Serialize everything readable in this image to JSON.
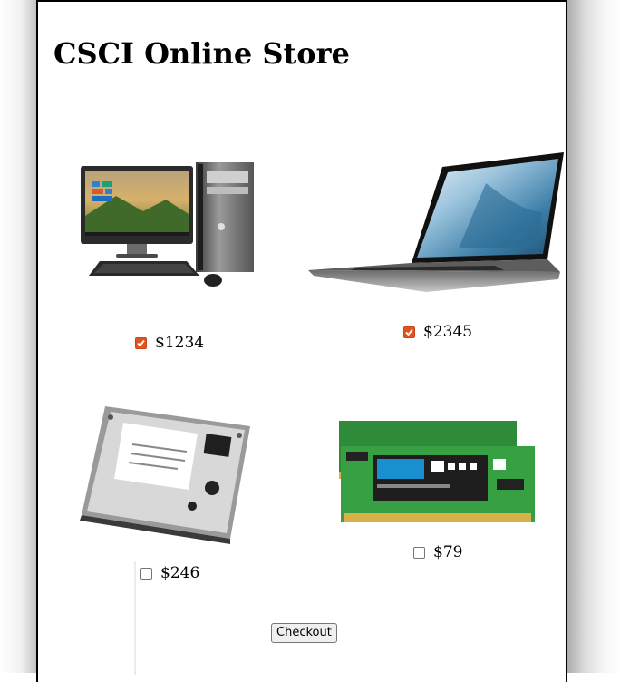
{
  "store": {
    "title": "CSCI Online Store"
  },
  "products": [
    {
      "name": "desktop-computer",
      "price": "$1234",
      "checked": true
    },
    {
      "name": "laptop",
      "price": "$2345",
      "checked": true
    },
    {
      "name": "hard-drive",
      "price": "$246",
      "checked": false
    },
    {
      "name": "memory-ram",
      "price": "$79",
      "checked": false
    }
  ],
  "actions": {
    "checkout_label": "Checkout"
  },
  "colors": {
    "checkbox_checked": "#e1541d",
    "border": "#000000"
  }
}
